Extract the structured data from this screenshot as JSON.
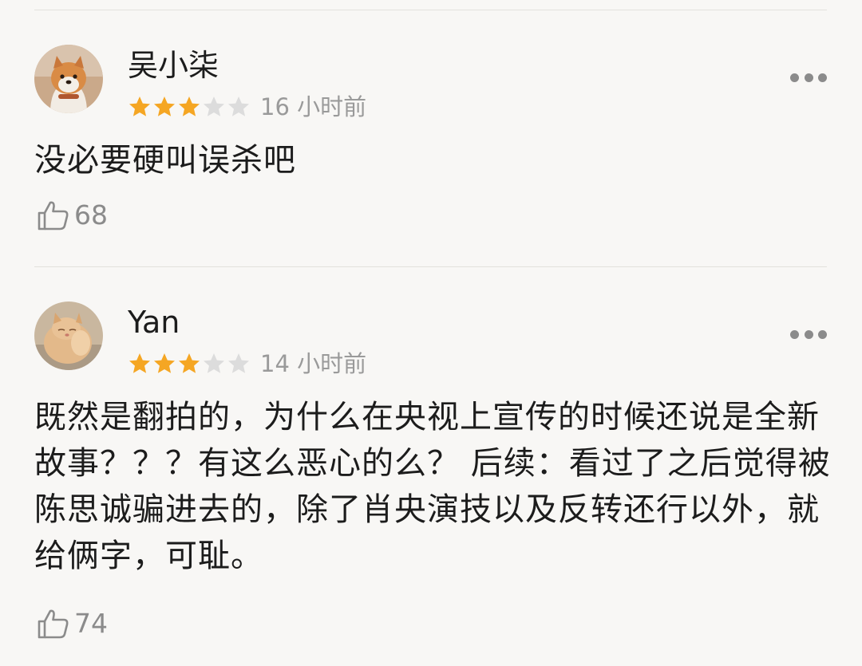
{
  "comments": [
    {
      "username": "吴小柒",
      "rating": 3,
      "max_rating": 5,
      "time": "16 小时前",
      "text": "没必要硬叫误杀吧",
      "likes": "68",
      "avatar": "shiba-dog-photo"
    },
    {
      "username": "Yan",
      "rating": 3,
      "max_rating": 5,
      "time": "14 小时前",
      "text": "既然是翻拍的，为什么在央视上宣传的时候还说是全新故事？？？有这么恶心的么？ 后续：看过了之后觉得被陈思诚骗进去的，除了肖央演技以及反转还行以外，就给俩字，可耻。",
      "likes": "74",
      "avatar": "orange-cat-photo"
    }
  ],
  "colors": {
    "star_filled": "#f5a623",
    "star_empty": "#dcdcdc",
    "meta_text": "#9a9a9a",
    "divider": "#e3e1dd"
  },
  "icons": [
    "more-dots-icon",
    "thumbs-up-icon",
    "star-icon"
  ]
}
